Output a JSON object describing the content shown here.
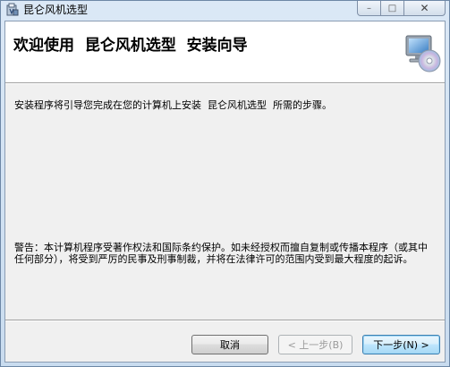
{
  "window": {
    "title": "昆仑风机选型",
    "controls": {
      "minimize": "–",
      "maximize": "□",
      "close": "✕"
    }
  },
  "header": {
    "title": "欢迎使用  昆仑风机选型  安装向导",
    "icon": "computer-cd-icon"
  },
  "body": {
    "intro": "安装程序将引导您完成在您的计算机上安装  昆仑风机选型  所需的步骤。",
    "warning": "警告：本计算机程序受著作权法和国际条约保护。如未经授权而擅自复制或传播本程序（或其中任何部分），将受到严厉的民事及刑事制裁，并将在法律许可的范围内受到最大程度的起诉。"
  },
  "buttons": {
    "cancel": "取消",
    "back": "< 上一步(B)",
    "next": "下一步(N) >"
  }
}
